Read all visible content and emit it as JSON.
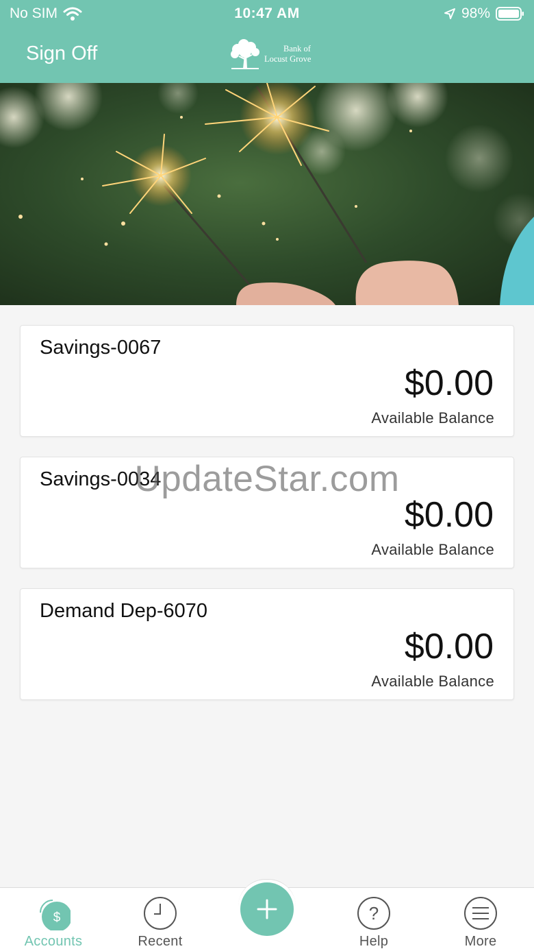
{
  "status_bar": {
    "carrier": "No SIM",
    "time": "10:47 AM",
    "battery": "98%"
  },
  "navbar": {
    "sign_off_label": "Sign Off",
    "logo_line1": "Bank of",
    "logo_line2": "Locust Grove"
  },
  "accounts": [
    {
      "name": "Savings-0067",
      "balance": "$0.00",
      "balance_label": "Available Balance"
    },
    {
      "name": "Savings-0034",
      "balance": "$0.00",
      "balance_label": "Available Balance"
    },
    {
      "name": "Demand Dep-6070",
      "balance": "$0.00",
      "balance_label": "Available Balance"
    }
  ],
  "watermark": "UpdateStar.com",
  "tabs": [
    {
      "label": "Accounts",
      "icon": "dollar-icon",
      "active": true
    },
    {
      "label": "Recent",
      "icon": "clock-icon",
      "active": false
    },
    {
      "label": "Help",
      "icon": "question-icon",
      "active": false
    },
    {
      "label": "More",
      "icon": "menu-icon",
      "active": false
    }
  ],
  "colors": {
    "brand": "#72c5b1",
    "background": "#f5f5f5",
    "card": "#ffffff"
  }
}
